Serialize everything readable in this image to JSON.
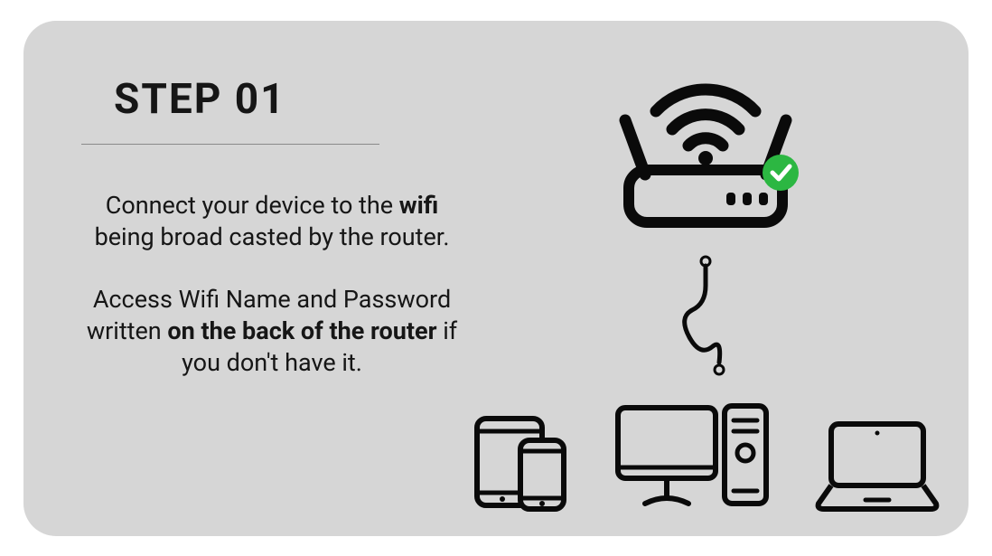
{
  "title": "STEP 01",
  "para1_pre": "Connect your device to the ",
  "para1_bold": "wifi",
  "para1_post": " being broad casted by the router.",
  "para2_pre": "Access Wifi Name and Password written ",
  "para2_bold": "on the back of the router",
  "para2_post": " if you don't have it."
}
